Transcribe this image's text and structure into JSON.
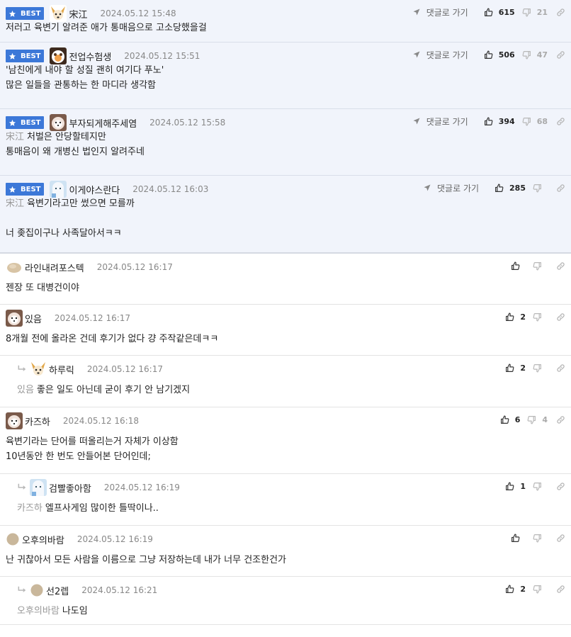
{
  "best_label": "BEST",
  "goto_label": "댓글로 가기",
  "best_comments": [
    {
      "nick": "宋江",
      "time": "2024.05.12 15:48",
      "up": "615",
      "down": "21",
      "avatar": "dog",
      "lines": [
        {
          "text": "저러고 육변기 알려준 애가 통매음으로 고소당했을걸"
        }
      ]
    },
    {
      "nick": "전업수험생",
      "time": "2024.05.12 15:51",
      "up": "506",
      "down": "47",
      "avatar": "panda",
      "lines": [
        {
          "text": "'남친에게 내야 할 성질 괜히 여기다 푸노'"
        },
        {
          "text": "많은 일들을 관통하는 한 마디라 생각함"
        }
      ]
    },
    {
      "nick": "부자되게해주세염",
      "time": "2024.05.12 15:58",
      "up": "394",
      "down": "68",
      "avatar": "pom",
      "lines": [
        {
          "ref": "宋江",
          "text": "처벌은 안당할테지만"
        },
        {
          "text": "통매음이 왜 개병신 법인지 알려주네"
        }
      ]
    },
    {
      "nick": "이게야스란다",
      "time": "2024.05.12 16:03",
      "up": "285",
      "down": "",
      "avatar": "polar",
      "lines": [
        {
          "ref": "宋江",
          "text": "육변기라고만 썼으면 모를까"
        },
        {
          "text": ""
        },
        {
          "text": "너 좆집이구나 사족달아서ㅋㅋ"
        }
      ]
    }
  ],
  "comments": [
    {
      "nick": "라인내려포스텍",
      "time": "2024.05.12 16:17",
      "up": "",
      "down": "",
      "avatar": "potato",
      "reply": false,
      "lines": [
        {
          "text": "젠장 또 대병건이야"
        }
      ]
    },
    {
      "nick": "있음",
      "time": "2024.05.12 16:17",
      "up": "2",
      "down": "",
      "avatar": "pom",
      "reply": false,
      "lines": [
        {
          "text": "8개월 전에 올라온 건데 후기가 없다 걍 주작같은데ㅋㅋ"
        }
      ]
    },
    {
      "nick": "하루릭",
      "time": "2024.05.12 16:17",
      "up": "2",
      "down": "",
      "avatar": "dog",
      "reply": true,
      "lines": [
        {
          "ref": "있음",
          "text": "좋은 일도 아닌데 굳이 후기 안 남기겠지"
        }
      ]
    },
    {
      "nick": "카즈하",
      "time": "2024.05.12 16:18",
      "up": "6",
      "down": "4",
      "avatar": "pom",
      "reply": false,
      "lines": [
        {
          "text": "육변기라는 단어를 떠올리는거 자체가 이상함"
        },
        {
          "text": "10년동안 한 번도 안들어본 단어인데;"
        }
      ]
    },
    {
      "nick": "검빨좋아함",
      "time": "2024.05.12 16:19",
      "up": "1",
      "down": "",
      "avatar": "polar",
      "reply": true,
      "lines": [
        {
          "ref": "카즈하",
          "text": "엘프사게임 많이한 틀딱이나.."
        }
      ]
    },
    {
      "nick": "오후의바람",
      "time": "2024.05.12 16:19",
      "up": "",
      "down": "",
      "avatar": "dot",
      "reply": false,
      "lines": [
        {
          "text": "난 귀찮아서 모든 사람을 이름으로 그냥 저장하는데 내가 너무 건조한건가"
        }
      ]
    },
    {
      "nick": "선2렙",
      "time": "2024.05.12 16:21",
      "up": "2",
      "down": "",
      "avatar": "dot",
      "reply": true,
      "lines": [
        {
          "ref": "오후의바람",
          "text": "나도임"
        }
      ]
    }
  ]
}
